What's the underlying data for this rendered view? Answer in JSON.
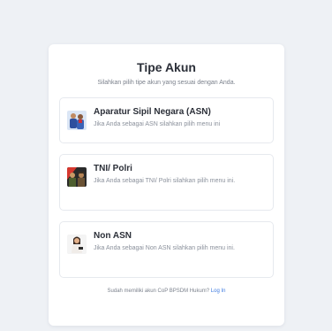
{
  "header": {
    "title": "Tipe Akun",
    "subtitle": "Silahkan pilih tipe akun yang sesuai dengan Anda."
  },
  "options": [
    {
      "title": "Aparatur Sipil Negara (ASN)",
      "desc": "Jika Anda sebagai ASN silahkan pilih menu ini",
      "icon": "asn-illustration-icon"
    },
    {
      "title": "TNI/ Polri",
      "desc": "Jika Anda sebagai TNI/ Polri silahkan pilih menu ini.",
      "icon": "tni-polri-illustration-icon"
    },
    {
      "title": "Non ASN",
      "desc": "Jika Anda sebagai Non ASN silahkan pilih menu ini.",
      "icon": "non-asn-illustration-icon"
    }
  ],
  "footer": {
    "text": "Sudah memiliki akun CoP BPSDM Hukum?",
    "link": "Log In"
  },
  "colors": {
    "background": "#eef1f5",
    "card": "#ffffff",
    "link": "#3f7be0",
    "text": "#2b2f38",
    "muted": "#8a909b"
  }
}
